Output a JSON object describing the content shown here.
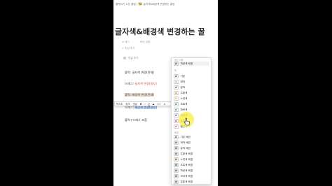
{
  "breadcrumb": {
    "part1": "블럭치기 노션 꿀팁",
    "part2": "글자색&배경색 변경하는 꿀팁"
  },
  "page": {
    "title": "글자색&배경색 변경하는 꿀",
    "meta1": "태그",
    "meta2": "비어 있음",
    "meta3": "속성 추가",
    "comment": "댓글 추가"
  },
  "content": {
    "line1": "블럭: 글자색 변경(전체)",
    "line2_prefix": "드래그: ",
    "line2_span": "글자색 변경(일부)",
    "line3": "블럭: 배경색 변경(전체)",
    "line4_prefix": "드래그: ",
    "line4_span": "배경색 변경(일부)",
    "line5": "블럭+드래그 조합"
  },
  "toolbar": {
    "text": "텍스트",
    "link": "링크",
    "comment": "댓글",
    "bold": "B",
    "italic": "i",
    "underline": "U",
    "strike": "S",
    "code": "<>",
    "color": "A"
  },
  "color_menu": {
    "recent_header": "최근 사용",
    "recent_item": "파란색 배경",
    "text_header": "텍",
    "text_colors": [
      {
        "label": "기본",
        "color": "#37352f"
      },
      {
        "label": "회색",
        "color": "#9b9a97"
      },
      {
        "label": "갈색",
        "color": "#64473a"
      },
      {
        "label": "주황색",
        "color": "#d9730d"
      },
      {
        "label": "노란색",
        "color": "#dfab01"
      },
      {
        "label": "초록색",
        "color": "#0f7b6c"
      },
      {
        "label": "파란색",
        "color": "#0b6e99"
      },
      {
        "label": "보라색",
        "color": "#6940a5"
      },
      {
        "label": "분홍색",
        "color": "#ad1a72"
      },
      {
        "label": "빨간색",
        "color": "#e03e3e"
      }
    ],
    "bg_header": "배경",
    "bg_colors": [
      {
        "label": "기본 배경",
        "color": "#ffffff"
      },
      {
        "label": "회색 배경",
        "color": "#ebeced"
      },
      {
        "label": "갈색 배경",
        "color": "#e9e5e3"
      },
      {
        "label": "주황색 배경",
        "color": "#faebdd"
      },
      {
        "label": "노란색 배경",
        "color": "#fbf3db"
      },
      {
        "label": "초록색 배경",
        "color": "#ddedea"
      },
      {
        "label": "파란색 배경",
        "color": "#ddebf1"
      },
      {
        "label": "보라색 배경",
        "color": "#eae4f2"
      },
      {
        "label": "분홍색 배경",
        "color": "#f4dfeb"
      }
    ]
  }
}
